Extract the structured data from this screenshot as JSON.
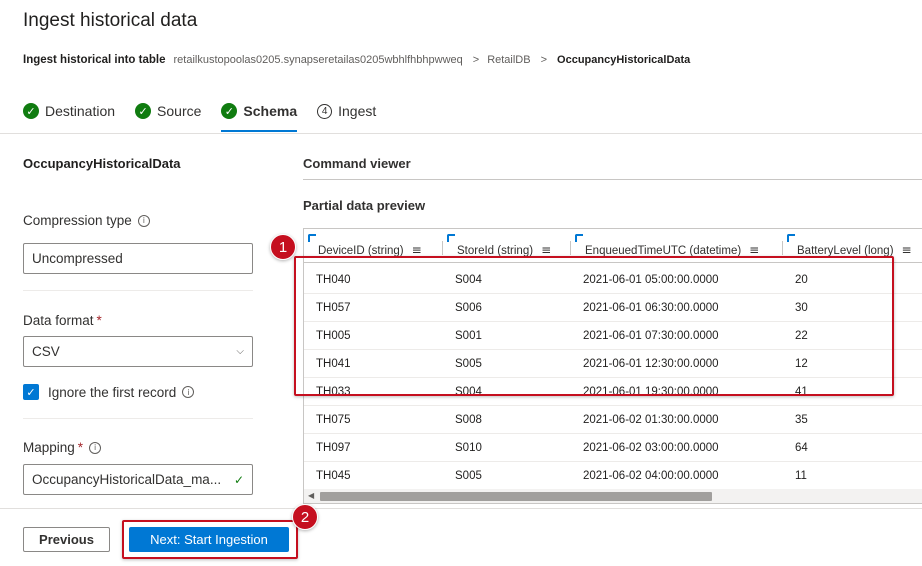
{
  "page": {
    "title": "Ingest historical data"
  },
  "breadcrumb": {
    "lead": "Ingest historical into table",
    "cluster": "retailkustopoolas0205.synapseretailas0205wbhlfhbhpwweq",
    "database": "RetailDB",
    "table": "OccupancyHistoricalData",
    "separator": ">"
  },
  "steps": [
    {
      "label": "Destination",
      "state": "done"
    },
    {
      "label": "Source",
      "state": "done"
    },
    {
      "label": "Schema",
      "state": "active"
    },
    {
      "label": "Ingest",
      "state": "pending",
      "number": "4"
    }
  ],
  "left_panel": {
    "table_name": "OccupancyHistoricalData",
    "compression": {
      "label": "Compression type",
      "value": "Uncompressed"
    },
    "data_format": {
      "label": "Data format",
      "required": "*",
      "value": "CSV"
    },
    "ignore_first": {
      "label": "Ignore the first record",
      "checked": true
    },
    "mapping": {
      "label": "Mapping",
      "required": "*",
      "value": "OccupancyHistoricalData_ma..."
    }
  },
  "right_panel": {
    "command_viewer": "Command viewer",
    "preview_title": "Partial data preview",
    "columns": [
      "DeviceID (string)",
      "StoreId (string)",
      "EnqueuedTimeUTC (datetime)",
      "BatteryLevel (long)"
    ],
    "rows": [
      [
        "TH040",
        "S004",
        "2021-06-01 05:00:00.0000",
        "20"
      ],
      [
        "TH057",
        "S006",
        "2021-06-01 06:30:00.0000",
        "30"
      ],
      [
        "TH005",
        "S001",
        "2021-06-01 07:30:00.0000",
        "22"
      ],
      [
        "TH041",
        "S005",
        "2021-06-01 12:30:00.0000",
        "12"
      ],
      [
        "TH033",
        "S004",
        "2021-06-01 19:30:00.0000",
        "41"
      ],
      [
        "TH075",
        "S008",
        "2021-06-02 01:30:00.0000",
        "35"
      ],
      [
        "TH097",
        "S010",
        "2021-06-02 03:00:00.0000",
        "64"
      ],
      [
        "TH045",
        "S005",
        "2021-06-02 04:00:00.0000",
        "11"
      ]
    ]
  },
  "callouts": [
    "1",
    "2"
  ],
  "footer": {
    "previous": "Previous",
    "next": "Next: Start Ingestion"
  },
  "colors": {
    "accent": "#0078d4",
    "success": "#107c10",
    "callout": "#c50f1f"
  }
}
